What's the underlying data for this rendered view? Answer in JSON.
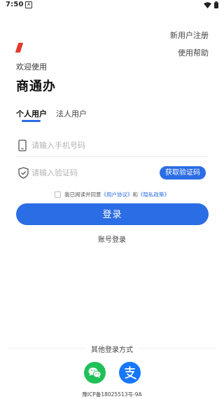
{
  "status_bar": {
    "time": "7:50"
  },
  "header": {
    "register_link": "新用户注册",
    "help_link": "使用帮助"
  },
  "brand": {
    "welcome": "欢迎使用",
    "app_name": "商通办",
    "logo_color": "#e23b2e"
  },
  "tabs": [
    {
      "label": "个人用户",
      "active": true
    },
    {
      "label": "法人用户",
      "active": false
    }
  ],
  "phone_field": {
    "placeholder": "请输入手机号码",
    "value": ""
  },
  "code_field": {
    "placeholder": "请输入验证码",
    "value": "",
    "button_label": "获取验证码"
  },
  "agreement": {
    "prefix": "我已阅读并同意",
    "user_agreement": "《用户协议》",
    "and": "和",
    "privacy_policy": "《隐私政策》",
    "checked": false
  },
  "login_button": "登录",
  "account_login": "账号登录",
  "other_login": {
    "title": "其他登录方式",
    "providers": [
      {
        "icon": "wechat-icon",
        "color": "#1fc058"
      },
      {
        "icon": "alipay-icon",
        "color": "#1677ff"
      }
    ]
  },
  "icp": "豫ICP备18025513号-9A",
  "accent_color": "#2b6de5"
}
